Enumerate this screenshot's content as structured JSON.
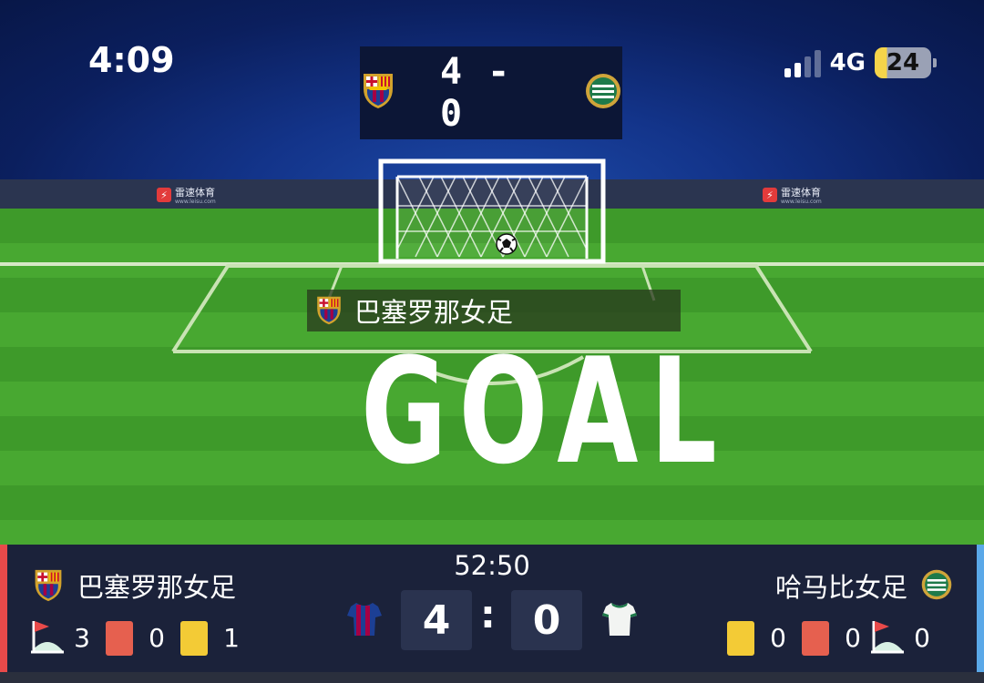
{
  "status_bar": {
    "time": "4:09",
    "network": "4G",
    "battery": "24"
  },
  "scoreboard_top": {
    "score": "4 - 0"
  },
  "ads": {
    "brand": "雷速体育",
    "url": "www.leisu.com"
  },
  "event": {
    "team": "巴塞罗那女足",
    "text": "GOAL"
  },
  "match": {
    "clock": "52:50",
    "home": {
      "name": "巴塞罗那女足",
      "score": "4",
      "corners": "3",
      "red_cards": "0",
      "yellow_cards": "1"
    },
    "away": {
      "name": "哈马比女足",
      "score": "0",
      "corners": "0",
      "red_cards": "0",
      "yellow_cards": "0"
    },
    "separator": ":"
  },
  "icons": {
    "home_crest": "barcelona-crest-icon",
    "away_crest": "hammarby-crest-icon",
    "corner": "corner-flag-icon",
    "home_kit": "home-jersey-icon",
    "away_kit": "away-jersey-icon"
  },
  "colors": {
    "accent_home": "#e84a4a",
    "accent_away": "#5aa8e8",
    "yellow_card": "#f3cb36",
    "red_card": "#e6604f"
  }
}
